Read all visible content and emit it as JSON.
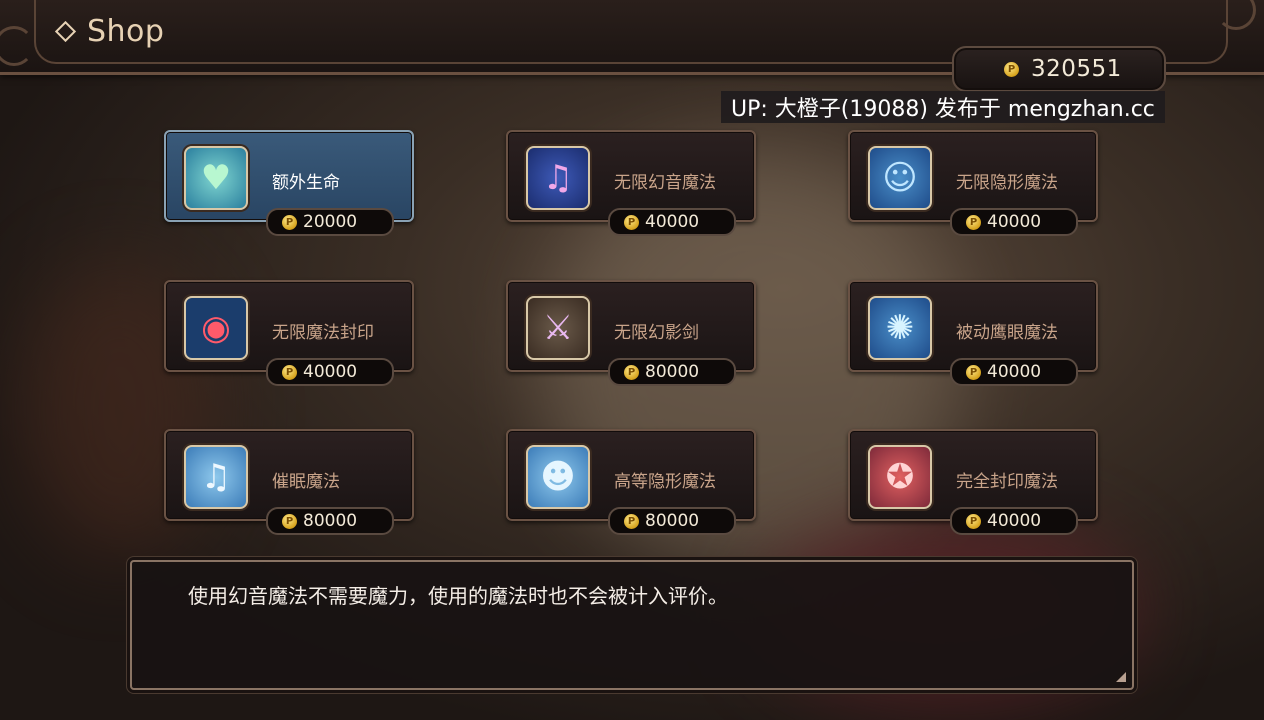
{
  "header": {
    "title": "Shop"
  },
  "currency": {
    "amount": "320551",
    "coin_symbol": "P"
  },
  "watermark": "UP: 大橙子(19088) 发布于 mengzhan.cc",
  "items": [
    {
      "name": "额外生命",
      "price": "20000",
      "icon": "heart-icon",
      "selected": true
    },
    {
      "name": "无限幻音魔法",
      "price": "40000",
      "icon": "music-note-icon",
      "selected": false
    },
    {
      "name": "无限隐形魔法",
      "price": "40000",
      "icon": "invisible-person-icon",
      "selected": false
    },
    {
      "name": "无限魔法封印",
      "price": "40000",
      "icon": "magic-seal-orb-icon",
      "selected": false
    },
    {
      "name": "无限幻影剑",
      "price": "80000",
      "icon": "sword-icon",
      "selected": false
    },
    {
      "name": "被动鹰眼魔法",
      "price": "40000",
      "icon": "hawk-eye-icon",
      "selected": false
    },
    {
      "name": "催眠魔法",
      "price": "80000",
      "icon": "hypnosis-note-icon",
      "selected": false
    },
    {
      "name": "高等隐形魔法",
      "price": "80000",
      "icon": "double-invisible-icon",
      "selected": false
    },
    {
      "name": "完全封印魔法",
      "price": "40000",
      "icon": "complete-seal-icon",
      "selected": false
    }
  ],
  "description": "使用幻音魔法不需要魔力，使用的魔法时也不会被计入评价。",
  "colors": {
    "selected_card": "#2f4e6e",
    "card": "#231a1a",
    "accent_text": "#c9a48a",
    "coin": "#d6a21c"
  }
}
